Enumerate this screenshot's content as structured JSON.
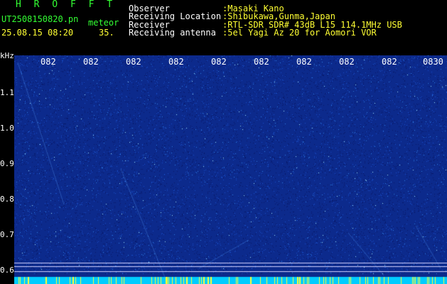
{
  "header": {
    "title": "H R O F F T",
    "file_name": "UT2508150820.pn",
    "tag": "meteor",
    "datetime": "25.08.15 08:20",
    "count": "35.",
    "fields": [
      {
        "label": "Observer",
        "value": ":Masaki Kano"
      },
      {
        "label": "Receiving Location",
        "value": ":Shibukawa,Gunma,Japan"
      },
      {
        "label": "Receiver",
        "value": ":RTL-SDR SDR# 43dB L15 114.1MHz USB"
      },
      {
        "label": "Receiving antenna",
        "value": ":5el Yagi Az 20 for Aomori VOR"
      }
    ]
  },
  "axis": {
    "unit": "kHz",
    "y_ticks": [
      {
        "label": "1.1",
        "value": 1.1
      },
      {
        "label": "1.0",
        "value": 1.0
      },
      {
        "label": "0.9",
        "value": 0.9
      },
      {
        "label": "0.8",
        "value": 0.8
      },
      {
        "label": "0.7",
        "value": 0.7
      },
      {
        "label": "0.6",
        "value": 0.6
      }
    ],
    "time_ticks": [
      "082",
      "082",
      "082",
      "082",
      "082",
      "082",
      "082",
      "082",
      "082",
      "0830"
    ]
  },
  "colors": {
    "background": "#000000",
    "spectrogram": "#0c2a8c",
    "noise_band": "#00ccff",
    "header_text": "#33ff33",
    "header_values": "#ffff33"
  }
}
